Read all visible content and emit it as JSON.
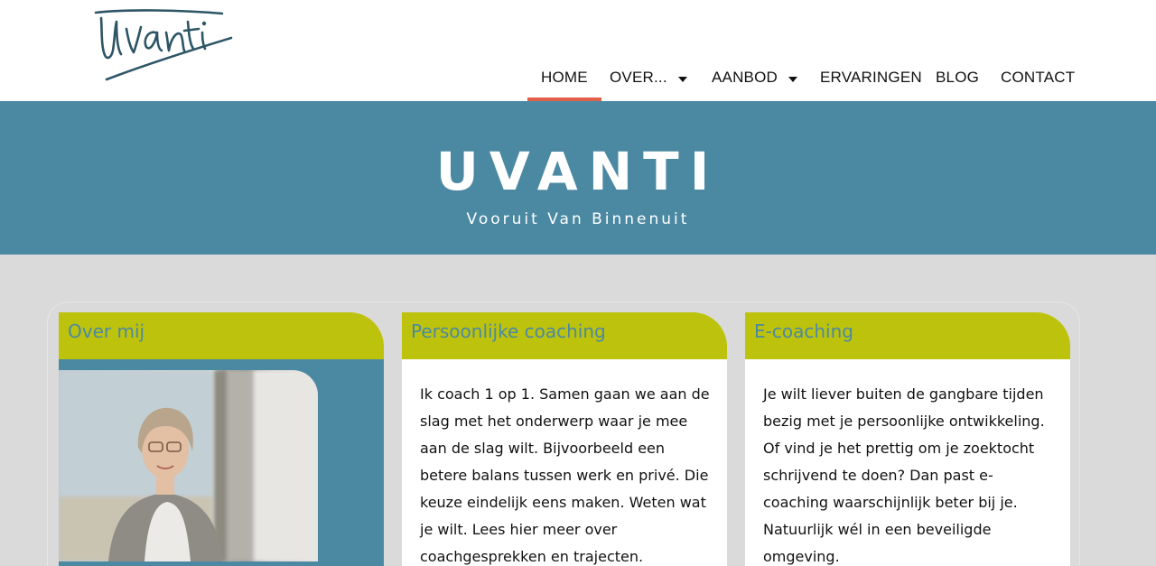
{
  "logo": {
    "name": "Uvanti"
  },
  "nav": {
    "items": [
      {
        "label": "HOME",
        "active": true,
        "dropdown": false
      },
      {
        "label": "OVER...",
        "active": false,
        "dropdown": true
      },
      {
        "label": "AANBOD",
        "active": false,
        "dropdown": true
      },
      {
        "label": "ERVARINGEN",
        "active": false,
        "dropdown": false
      },
      {
        "label": "BLOG",
        "active": false,
        "dropdown": false
      },
      {
        "label": "CONTACT",
        "active": false,
        "dropdown": false
      }
    ]
  },
  "hero": {
    "title": "UVANTI",
    "subtitle": "Vooruit Van Binnenuit"
  },
  "cards": [
    {
      "title": "Over mij",
      "text": ""
    },
    {
      "title": "Persoonlijke coaching",
      "text": "Ik coach 1 op 1. Samen gaan we aan de slag met het onderwerp waar je mee aan de slag wilt. Bijvoorbeeld een betere balans tussen werk en privé. Die keuze eindelijk eens maken. Weten wat je wilt. Lees hier meer over coachgesprekken en trajecten."
    },
    {
      "title": "E-coaching",
      "text": "Je wilt liever buiten de gangbare tijden bezig met je persoonlijke ontwikkeling. Of vind je het prettig om je zoektocht schrijvend te doen? Dan past e-coaching waarschijnlijk beter bij je. Natuurlijk wél in een beveiligde omgeving."
    }
  ],
  "colors": {
    "hero": "#4b89a3",
    "card_header": "#bdc30c",
    "active_underline": "#e0604a",
    "logo_ink": "#2d5566"
  }
}
